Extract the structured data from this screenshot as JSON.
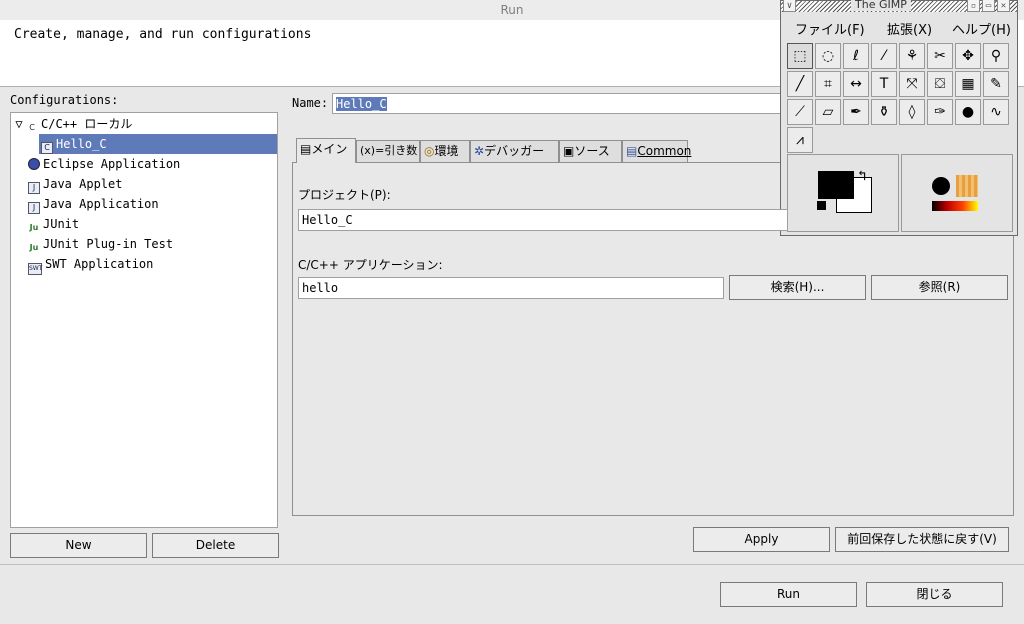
{
  "window": {
    "title": "Run",
    "controls": [
      "▫",
      "▭",
      "✕"
    ]
  },
  "header": {
    "message": "Create, manage, and run configurations"
  },
  "configs": {
    "label": "Configurations:",
    "tree": [
      {
        "label": "C/C++ ローカル",
        "icon": "c-config-icon",
        "expander": "▽"
      },
      {
        "label": "Hello_C",
        "icon": "c-config-icon",
        "selected": true
      },
      {
        "label": "Eclipse Application",
        "icon": "eclipse-icon"
      },
      {
        "label": "Java Applet",
        "icon": "java-applet-icon"
      },
      {
        "label": "Java Application",
        "icon": "java-app-icon"
      },
      {
        "label": "JUnit",
        "icon": "junit-icon"
      },
      {
        "label": "JUnit Plug-in Test",
        "icon": "junit-plugin-icon"
      },
      {
        "label": "SWT Application",
        "icon": "swt-icon"
      }
    ],
    "icon_text": {
      "c": "C",
      "j": "J",
      "ju": "Ju",
      "swt": "SWT"
    },
    "new_label": "New",
    "delete_label": "Delete"
  },
  "name_field": {
    "label": "Name:",
    "value": "Hello_C"
  },
  "tabs": [
    {
      "label": "メイン",
      "icon": "main-tab-icon",
      "glyph": "▤"
    },
    {
      "label": "(x)=引き数",
      "icon": "args-tab-icon",
      "glyph": ""
    },
    {
      "label": "環境",
      "icon": "env-tab-icon",
      "glyph": "◎"
    },
    {
      "label": "デバッガー",
      "icon": "debugger-tab-icon",
      "glyph": "✲"
    },
    {
      "label": "ソース",
      "icon": "source-tab-icon",
      "glyph": "▣"
    },
    {
      "label": "Common",
      "icon": "common-tab-icon",
      "glyph": "▤"
    }
  ],
  "main_tab": {
    "project_label": "プロジェクト(P):",
    "project_value": "Hello_C",
    "app_label": "C/C++ アプリケーション:",
    "app_value": "hello",
    "search_label": "検索(H)...",
    "browse_label": "参照(R)"
  },
  "buttons": {
    "apply": "Apply",
    "revert": "前回保存した状態に戻す(V)",
    "run": "Run",
    "close": "閉じる"
  },
  "gimp": {
    "title": "The GIMP",
    "menu": [
      "ファイル(F)",
      "拡張(X)",
      "ヘルプ(H)"
    ],
    "tools": [
      {
        "name": "rect-select-tool-icon",
        "glyph": "⬚"
      },
      {
        "name": "ellipse-select-tool-icon",
        "glyph": "◌"
      },
      {
        "name": "lasso-tool-icon",
        "glyph": "ℓ"
      },
      {
        "name": "magic-wand-tool-icon",
        "glyph": "⁄"
      },
      {
        "name": "fuzzy-select-tool-icon",
        "glyph": "⚘"
      },
      {
        "name": "scissors-tool-icon",
        "glyph": "✂"
      },
      {
        "name": "move-tool-icon",
        "glyph": "✥"
      },
      {
        "name": "zoom-tool-icon",
        "glyph": "⚲"
      },
      {
        "name": "knife-tool-icon",
        "glyph": "╱"
      },
      {
        "name": "crop-tool-icon",
        "glyph": "⌗"
      },
      {
        "name": "flip-tool-icon",
        "glyph": "↔"
      },
      {
        "name": "text-tool-icon",
        "glyph": "T"
      },
      {
        "name": "color-picker-tool-icon",
        "glyph": "⤧"
      },
      {
        "name": "bucket-fill-tool-icon",
        "glyph": "⛋"
      },
      {
        "name": "gradient-tool-icon",
        "glyph": "▦"
      },
      {
        "name": "pencil-tool-icon",
        "glyph": "✎"
      },
      {
        "name": "paintbrush-tool-icon",
        "glyph": "⟋"
      },
      {
        "name": "eraser-tool-icon",
        "glyph": "▱"
      },
      {
        "name": "airbrush-tool-icon",
        "glyph": "✒"
      },
      {
        "name": "clone-tool-icon",
        "glyph": "⚱"
      },
      {
        "name": "blur-tool-icon",
        "glyph": "◊"
      },
      {
        "name": "ink-tool-icon",
        "glyph": "✑"
      },
      {
        "name": "dodge-tool-icon",
        "glyph": "●"
      },
      {
        "name": "smudge-tool-icon",
        "glyph": "∿"
      },
      {
        "name": "measure-tool-icon",
        "glyph": "⩘"
      }
    ],
    "fg_color": "#000000",
    "bg_color": "#ffffff",
    "swap_glyph": "↰"
  }
}
